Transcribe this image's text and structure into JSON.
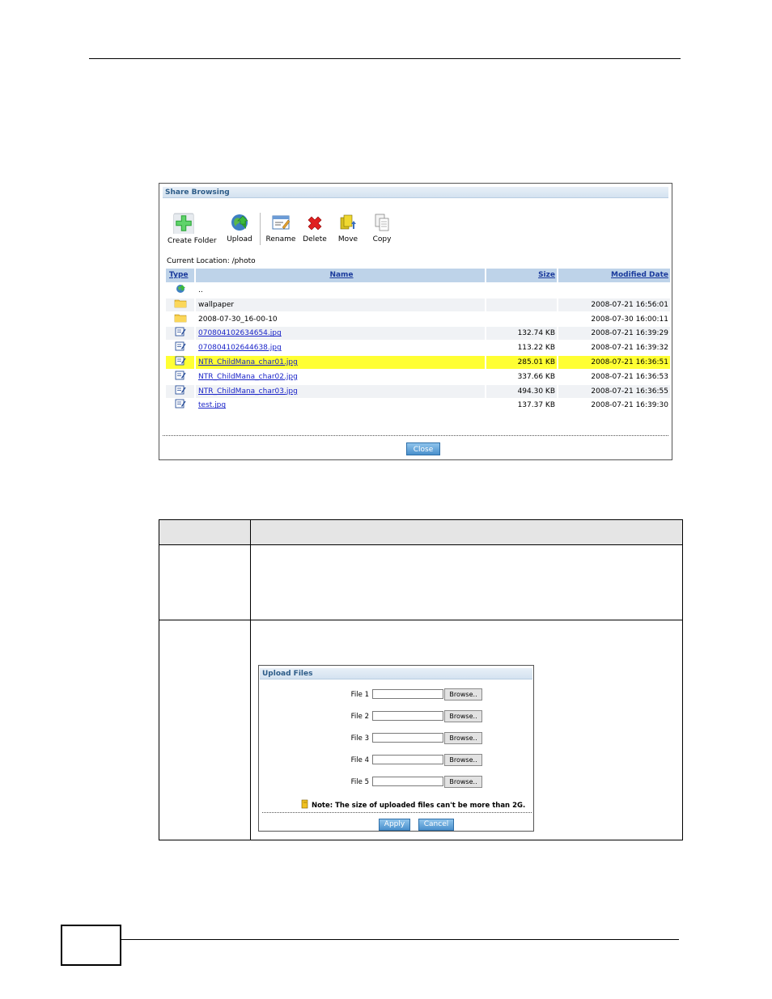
{
  "share_browsing": {
    "title": "Share Browsing",
    "toolbar": {
      "create_folder": "Create Folder",
      "upload": "Upload",
      "rename": "Rename",
      "delete": "Delete",
      "move": "Move",
      "copy": "Copy"
    },
    "current_location": "Current Location: /photo",
    "columns": {
      "type": "Type",
      "name": "Name",
      "size": "Size",
      "modified": "Modified Date"
    },
    "rows": [
      {
        "icon": "up-folder-icon",
        "name": "..",
        "size": "",
        "modified": "",
        "link": false
      },
      {
        "icon": "folder-icon",
        "name": "wallpaper",
        "size": "",
        "modified": "2008-07-21 16:56:01",
        "link": false
      },
      {
        "icon": "folder-icon",
        "name": "2008-07-30_16-00-10",
        "size": "",
        "modified": "2008-07-30 16:00:11",
        "link": false
      },
      {
        "icon": "file-icon",
        "name": "070804102634654.jpg",
        "size": "132.74 KB",
        "modified": "2008-07-21 16:39:29",
        "link": true
      },
      {
        "icon": "file-icon",
        "name": "070804102644638.jpg",
        "size": "113.22 KB",
        "modified": "2008-07-21 16:39:32",
        "link": true
      },
      {
        "icon": "file-icon",
        "name": "NTR_ChildMana_char01.jpg",
        "size": "285.01 KB",
        "modified": "2008-07-21 16:36:51",
        "link": true,
        "selected": true
      },
      {
        "icon": "file-icon",
        "name": "NTR_ChildMana_char02.jpg",
        "size": "337.66 KB",
        "modified": "2008-07-21 16:36:53",
        "link": true
      },
      {
        "icon": "file-icon",
        "name": "NTR_ChildMana_char03.jpg",
        "size": "494.30 KB",
        "modified": "2008-07-21 16:36:55",
        "link": true
      },
      {
        "icon": "file-icon",
        "name": "test.jpg",
        "size": "137.37 KB",
        "modified": "2008-07-21 16:39:30",
        "link": true
      }
    ],
    "close_label": "Close"
  },
  "upload_files": {
    "title": "Upload Files",
    "files": [
      {
        "label": "File 1",
        "browse": "Browse.."
      },
      {
        "label": "File 2",
        "browse": "Browse.."
      },
      {
        "label": "File 3",
        "browse": "Browse.."
      },
      {
        "label": "File 4",
        "browse": "Browse.."
      },
      {
        "label": "File 5",
        "browse": "Browse.."
      }
    ],
    "note": "Note: The size of uploaded files can't be more than 2G.",
    "apply_label": "Apply",
    "cancel_label": "Cancel"
  },
  "colors": {
    "highlight": "#ffff33",
    "header": "#bed3e9",
    "link": "#1a24c8",
    "button": "#4a90cc"
  }
}
